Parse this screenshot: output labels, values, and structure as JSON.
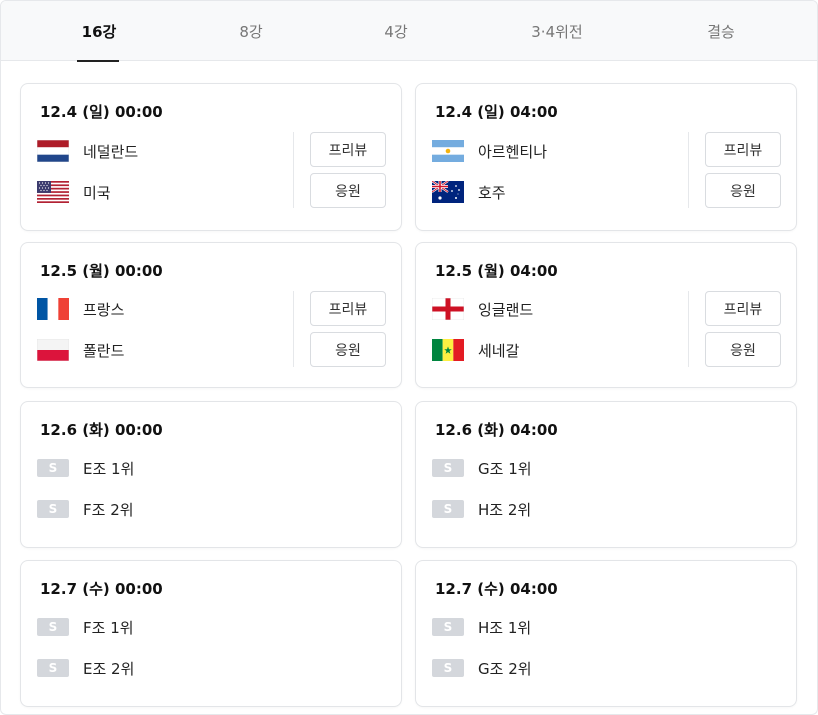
{
  "tabs": [
    {
      "label": "16강",
      "active": true
    },
    {
      "label": "8강",
      "active": false
    },
    {
      "label": "4강",
      "active": false
    },
    {
      "label": "3·4위전",
      "active": false
    },
    {
      "label": "결승",
      "active": false
    }
  ],
  "matches": [
    {
      "date": "12.4 (일) 00:00",
      "team1": {
        "name": "네덜란드",
        "flag": "netherlands-flag-icon"
      },
      "team2": {
        "name": "미국",
        "flag": "usa-flag-icon"
      },
      "preview_label": "프리뷰",
      "cheer_label": "응원"
    },
    {
      "date": "12.4 (일) 04:00",
      "team1": {
        "name": "아르헨티나",
        "flag": "argentina-flag-icon"
      },
      "team2": {
        "name": "호주",
        "flag": "australia-flag-icon"
      },
      "preview_label": "프리뷰",
      "cheer_label": "응원"
    },
    {
      "date": "12.5 (월) 00:00",
      "team1": {
        "name": "프랑스",
        "flag": "france-flag-icon"
      },
      "team2": {
        "name": "폴란드",
        "flag": "poland-flag-icon"
      },
      "preview_label": "프리뷰",
      "cheer_label": "응원"
    },
    {
      "date": "12.5 (월) 04:00",
      "team1": {
        "name": "잉글랜드",
        "flag": "england-flag-icon"
      },
      "team2": {
        "name": "세네갈",
        "flag": "senegal-flag-icon"
      },
      "preview_label": "프리뷰",
      "cheer_label": "응원"
    },
    {
      "date": "12.6 (화) 00:00",
      "team1": {
        "name": "E조 1위",
        "badge": "S"
      },
      "team2": {
        "name": "F조 2위",
        "badge": "S"
      }
    },
    {
      "date": "12.6 (화) 04:00",
      "team1": {
        "name": "G조 1위",
        "badge": "S"
      },
      "team2": {
        "name": "H조 2위",
        "badge": "S"
      }
    },
    {
      "date": "12.7 (수) 00:00",
      "team1": {
        "name": "F조 1위",
        "badge": "S"
      },
      "team2": {
        "name": "E조 2위",
        "badge": "S"
      }
    },
    {
      "date": "12.7 (수) 04:00",
      "team1": {
        "name": "H조 1위",
        "badge": "S"
      },
      "team2": {
        "name": "G조 2위",
        "badge": "S"
      }
    }
  ]
}
